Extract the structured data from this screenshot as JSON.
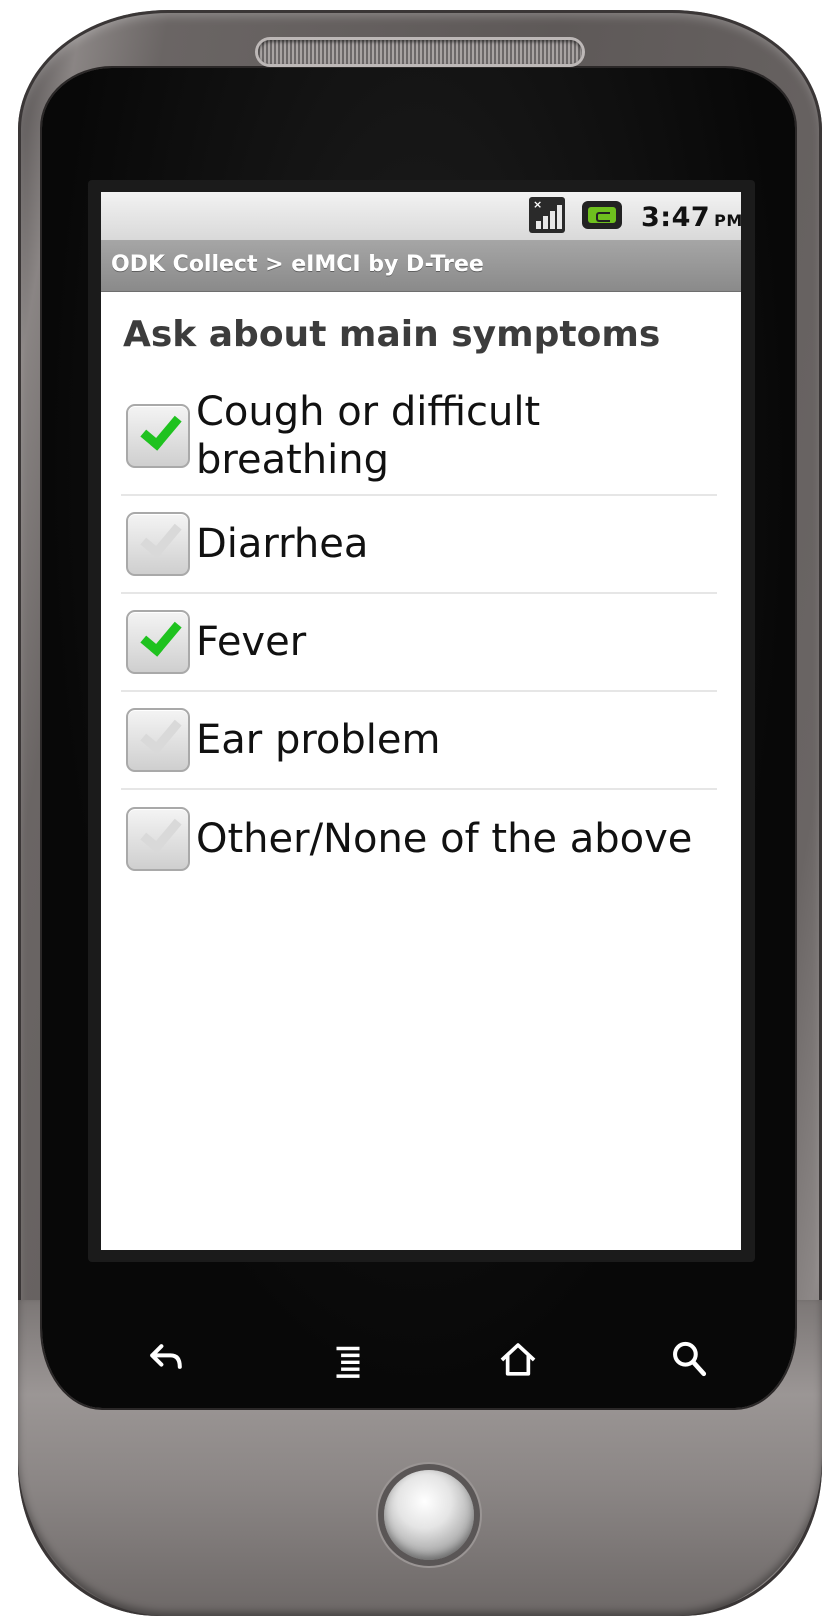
{
  "status_bar": {
    "time": "3:47",
    "ampm": "PM",
    "signal_icon": "signal-no-sim-icon",
    "battery_icon": "battery-charging-icon"
  },
  "title_bar": {
    "title": "ODK Collect > eIMCI by D-Tree"
  },
  "form": {
    "question": "Ask about main symptoms",
    "options": [
      {
        "label": "Cough or difficult breathing",
        "checked": true
      },
      {
        "label": "Diarrhea",
        "checked": false
      },
      {
        "label": "Fever",
        "checked": true
      },
      {
        "label": "Ear problem",
        "checked": false
      },
      {
        "label": "Other/None of the above",
        "checked": false
      }
    ]
  },
  "hardware_buttons": [
    "back-icon",
    "menu-icon",
    "home-icon",
    "search-icon"
  ],
  "colors": {
    "check_on": "#1fc21f",
    "check_off": "#d9d9d9",
    "titlebar": "#8a8a8a"
  }
}
